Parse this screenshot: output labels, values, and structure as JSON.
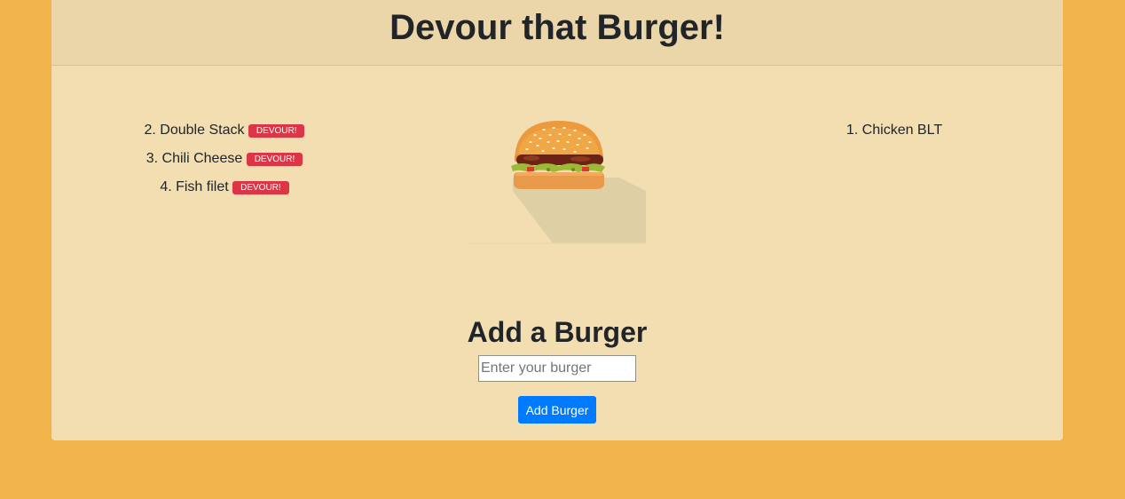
{
  "header": {
    "title": "Devour that Burger!"
  },
  "uneaten": [
    {
      "label": "2. Double Stack",
      "button": "DEVOUR!"
    },
    {
      "label": "3. Chili Cheese",
      "button": "DEVOUR!"
    },
    {
      "label": "4. Fish filet",
      "button": "DEVOUR!"
    }
  ],
  "devoured": [
    {
      "label": "1. Chicken BLT"
    }
  ],
  "form": {
    "title": "Add a Burger",
    "placeholder": "Enter your burger",
    "value": "",
    "submit_label": "Add Burger"
  },
  "colors": {
    "page_background": "#f0b44b",
    "card_background": "#f2deb1",
    "devour_button": "#dc3545",
    "add_button": "#007bff"
  }
}
